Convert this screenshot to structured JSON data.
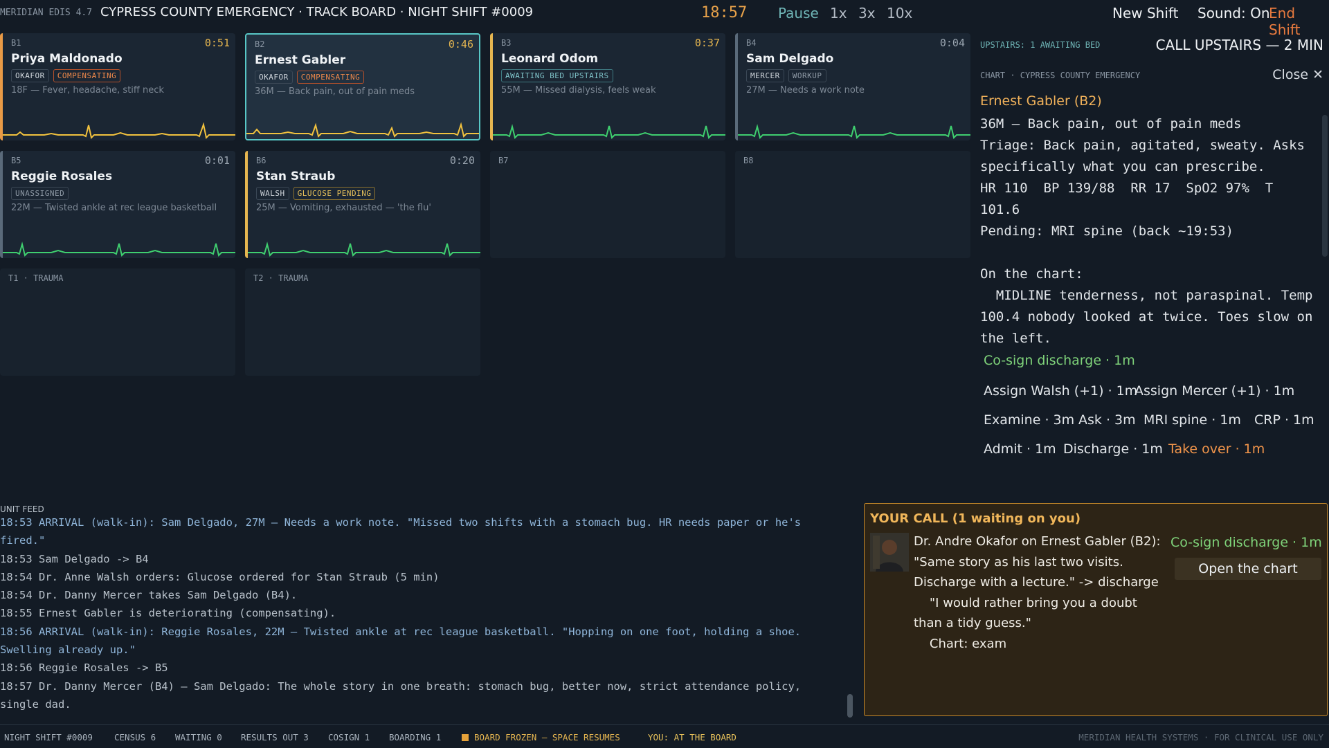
{
  "topbar": {
    "app_version": "MERIDIAN EDIS 4.7",
    "title": "CYPRESS COUNTY EMERGENCY · TRACK BOARD · NIGHT SHIFT #0009",
    "clock": "18:57",
    "pause": "Pause",
    "speed_1x": "1x",
    "speed_3x": "3x",
    "speed_10x": "10x",
    "new_shift": "New Shift",
    "sound": "Sound: On",
    "end_shift": "End Shift"
  },
  "beds": [
    {
      "bed": "B1",
      "timer": "0:51",
      "name": "Priya Maldonado",
      "tags": [
        "OKAFOR",
        "COMPENSATING"
      ],
      "complaint": "18F — Fever, headache, stiff neck"
    },
    {
      "bed": "B2",
      "timer": "0:46",
      "name": "Ernest Gabler",
      "tags": [
        "OKAFOR",
        "COMPENSATING"
      ],
      "complaint": "36M — Back pain, out of pain meds"
    },
    {
      "bed": "B3",
      "timer": "0:37",
      "name": "Leonard Odom",
      "tags": [
        "AWAITING BED UPSTAIRS"
      ],
      "complaint": "55M — Missed dialysis, feels weak"
    },
    {
      "bed": "B4",
      "timer": "0:04",
      "name": "Sam Delgado",
      "tags": [
        "MERCER",
        "WORKUP"
      ],
      "complaint": "27M — Needs a work note"
    },
    {
      "bed": "B5",
      "timer": "0:01",
      "name": "Reggie Rosales",
      "tags": [
        "UNASSIGNED"
      ],
      "complaint": "22M — Twisted ankle at rec league basketball"
    },
    {
      "bed": "B6",
      "timer": "0:20",
      "name": "Stan Straub",
      "tags": [
        "WALSH",
        "GLUCOSE PENDING"
      ],
      "complaint": "25M — Vomiting, exhausted — 'the flu'"
    },
    {
      "bed": "B7"
    },
    {
      "bed": "B8"
    },
    {
      "bed": "T1 · TRAUMA"
    },
    {
      "bed": "T2 · TRAUMA"
    }
  ],
  "chart": {
    "upstairs": "UPSTAIRS: 1 AWAITING BED",
    "call_upstairs": "CALL UPSTAIRS — 2 MIN",
    "header": "CHART · CYPRESS COUNTY EMERGENCY",
    "close": "Close ✕",
    "title": "Ernest Gabler (B2)",
    "body": "36M — Back pain, out of pain meds\nTriage: Back pain, agitated, sweaty. Asks specifically what you can prescribe.\nHR 110  BP 139/88  RR 17  SpO2 97%  T 101.6\nPending: MRI spine (back ~19:53)\n\nOn the chart:\n  MIDLINE tenderness, not paraspinal. Temp 100.4 nobody looked at twice. Toes slow on the left.",
    "actions": {
      "cosign": "Co-sign discharge · 1m",
      "assign_walsh": "Assign Walsh (+1) · 1m",
      "assign_mercer": "Assign Mercer (+1) · 1m",
      "examine": "Examine · 3m",
      "ask": "Ask · 3m",
      "mri": "MRI spine · 1m",
      "crp": "CRP · 1m",
      "admit": "Admit · 1m",
      "discharge": "Discharge · 1m",
      "take_over": "Take over · 1m"
    }
  },
  "feed": {
    "label": "UNIT FEED",
    "lines": [
      {
        "text": "18:53  ARRIVAL (walk-in): Sam Delgado, 27M — Needs a work note. \"Missed two shifts with a stomach bug. HR needs paper or he's fired.\"",
        "kind": "arrival"
      },
      {
        "text": "18:53  Sam Delgado -> B4",
        "kind": "normal"
      },
      {
        "text": "18:54  Dr. Anne Walsh orders: Glucose ordered for Stan Straub (5 min)",
        "kind": "normal"
      },
      {
        "text": "18:54  Dr. Danny Mercer takes Sam Delgado (B4).",
        "kind": "normal"
      },
      {
        "text": "18:55  Ernest Gabler is deteriorating (compensating).",
        "kind": "normal"
      },
      {
        "text": "18:56  ARRIVAL (walk-in): Reggie Rosales, 22M — Twisted ankle at rec league basketball. \"Hopping on one foot, holding a shoe. Swelling already up.\"",
        "kind": "arrival"
      },
      {
        "text": "18:56  Reggie Rosales -> B5",
        "kind": "normal"
      },
      {
        "text": "18:57  Dr. Danny Mercer (B4) — Sam Delgado: The whole story in one breath: stomach bug, better now, strict attendance policy, single dad.",
        "kind": "normal"
      }
    ]
  },
  "call": {
    "header": "YOUR CALL  (1 waiting on you)",
    "message": "Dr. Andre Okafor on Ernest Gabler (B2): \"Same story as his last two visits. Discharge with a lecture.\" -> discharge\n    \"I would rather bring you a doubt than a tidy guess.\"\n    Chart: exam",
    "cosign": "Co-sign discharge · 1m",
    "open_chart": "Open the chart"
  },
  "status": {
    "shift": "NIGHT SHIFT #0009",
    "census": "CENSUS 6",
    "waiting": "WAITING 0",
    "results": "RESULTS OUT 3",
    "cosign": "COSIGN 1",
    "boarding": "BOARDING 1",
    "frozen": "BOARD FROZEN — SPACE RESUMES",
    "you": "YOU: AT THE BOARD",
    "footer": "MERIDIAN HEALTH SYSTEMS · FOR CLINICAL USE ONLY"
  },
  "colors": {
    "accent_orange": "#e99a46",
    "accent_yellow": "#e6b650",
    "selected_teal": "#58c7c6",
    "ecg_green": "#3fcf6f",
    "ecg_yellow": "#f2c23e"
  }
}
